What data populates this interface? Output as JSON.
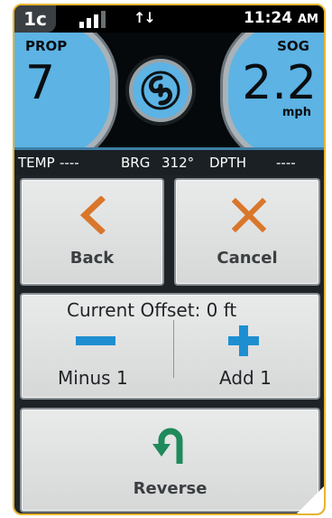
{
  "status_bar": {
    "badge": "1c",
    "signal_icon": "signal-bars-icon",
    "transfer_icon": "up-down-arrows-icon",
    "time": "11:24",
    "ampm": "AM"
  },
  "gauges": {
    "left": {
      "label": "PROP",
      "value": "7"
    },
    "right": {
      "label": "SOG",
      "value": "2.2",
      "unit": "mph"
    },
    "logo_icon": "spiral-logo-icon"
  },
  "info_bar": {
    "temp_label": "TEMP",
    "temp_value": "----",
    "brg_label": "BRG",
    "brg_value": "312°",
    "dpth_label": "DPTH",
    "dpth_value": "----"
  },
  "buttons": {
    "back": {
      "label": "Back",
      "icon": "chevron-left-icon"
    },
    "cancel": {
      "label": "Cancel",
      "icon": "x-icon"
    },
    "offset": {
      "title": "Current Offset: 0 ft",
      "minus_label": "Minus 1",
      "minus_icon": "minus-icon",
      "add_label": "Add 1",
      "add_icon": "plus-icon"
    },
    "reverse": {
      "label": "Reverse",
      "icon": "u-turn-icon"
    }
  },
  "colors": {
    "accent_orange": "#d9762b",
    "accent_blue": "#1d8fd1",
    "accent_green": "#1f8a5b",
    "gauge_blue": "#5cb3e4",
    "frame_gold": "#e8b530"
  }
}
